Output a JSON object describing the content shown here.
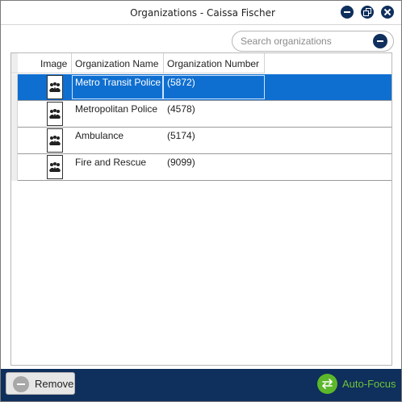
{
  "window": {
    "title": "Organizations - Caissa Fischer",
    "buttons": {
      "minimize": "minimize-icon",
      "restore": "restore-icon",
      "close": "close-icon"
    }
  },
  "search": {
    "placeholder": "Search organizations",
    "value": ""
  },
  "grid": {
    "columns": [
      "Image",
      "Organization Name",
      "Organization Number"
    ],
    "rows": [
      {
        "image": "organization-icon",
        "name": "Metro Transit Police",
        "number": "(5872)",
        "selected": true
      },
      {
        "image": "organization-icon",
        "name": "Metropolitan Police",
        "number": "(4578)",
        "selected": false
      },
      {
        "image": "organization-icon",
        "name": "Ambulance",
        "number": "(5174)",
        "selected": false
      },
      {
        "image": "organization-icon",
        "name": "Fire and Rescue",
        "number": "(9099)",
        "selected": false
      }
    ]
  },
  "footer": {
    "remove_label": "Remove",
    "autofocus_label": "Auto-Focus"
  },
  "colors": {
    "accent": "#0f2f5c",
    "selection": "#0f6fd0",
    "autofocus_green": "#5cb82a"
  }
}
